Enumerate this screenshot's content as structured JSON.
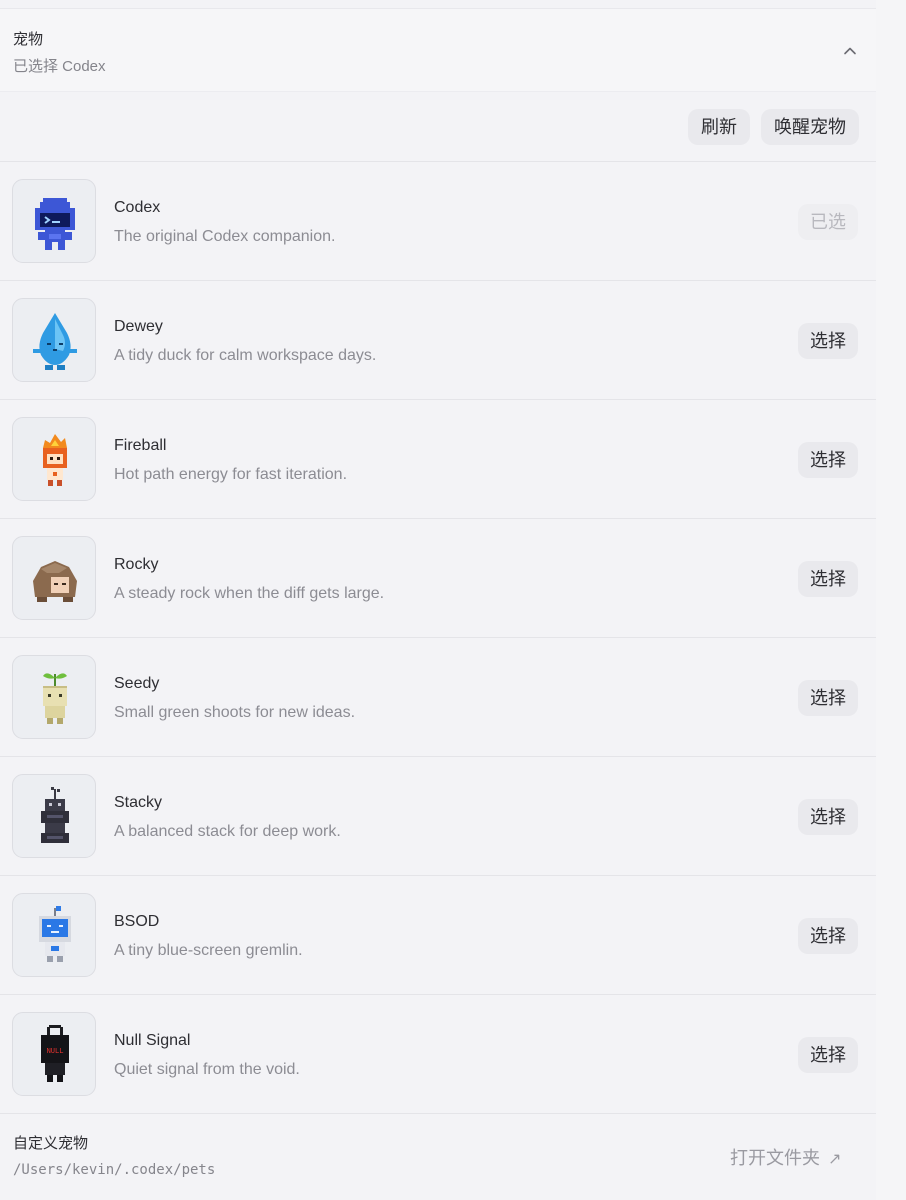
{
  "section": {
    "title": "宠物",
    "subtitle": "已选择 Codex",
    "chevron_icon": "chevron-up-icon"
  },
  "toolbar": {
    "refresh_label": "刷新",
    "wake_label": "唤醒宠物"
  },
  "pets": [
    {
      "name": "Codex",
      "description": "The original Codex companion.",
      "action": "已选",
      "selected": true,
      "icon": "codex-robot-icon"
    },
    {
      "name": "Dewey",
      "description": "A tidy duck for calm workspace days.",
      "action": "选择",
      "selected": false,
      "icon": "water-drop-icon"
    },
    {
      "name": "Fireball",
      "description": "Hot path energy for fast iteration.",
      "action": "选择",
      "selected": false,
      "icon": "fireball-icon"
    },
    {
      "name": "Rocky",
      "description": "A steady rock when the diff gets large.",
      "action": "选择",
      "selected": false,
      "icon": "rock-icon"
    },
    {
      "name": "Seedy",
      "description": "Small green shoots for new ideas.",
      "action": "选择",
      "selected": false,
      "icon": "sprout-icon"
    },
    {
      "name": "Stacky",
      "description": "A balanced stack for deep work.",
      "action": "选择",
      "selected": false,
      "icon": "stack-icon"
    },
    {
      "name": "BSOD",
      "description": "A tiny blue-screen gremlin.",
      "action": "选择",
      "selected": false,
      "icon": "monitor-robot-icon"
    },
    {
      "name": "Null Signal",
      "description": "Quiet signal from the void.",
      "action": "选择",
      "selected": false,
      "icon": "null-signal-icon",
      "badge_text": "NULL"
    }
  ],
  "footer": {
    "title": "自定义宠物",
    "path": "/Users/kevin/.codex/pets",
    "open_folder_label": "打开文件夹",
    "open_icon": "external-arrow-icon"
  }
}
